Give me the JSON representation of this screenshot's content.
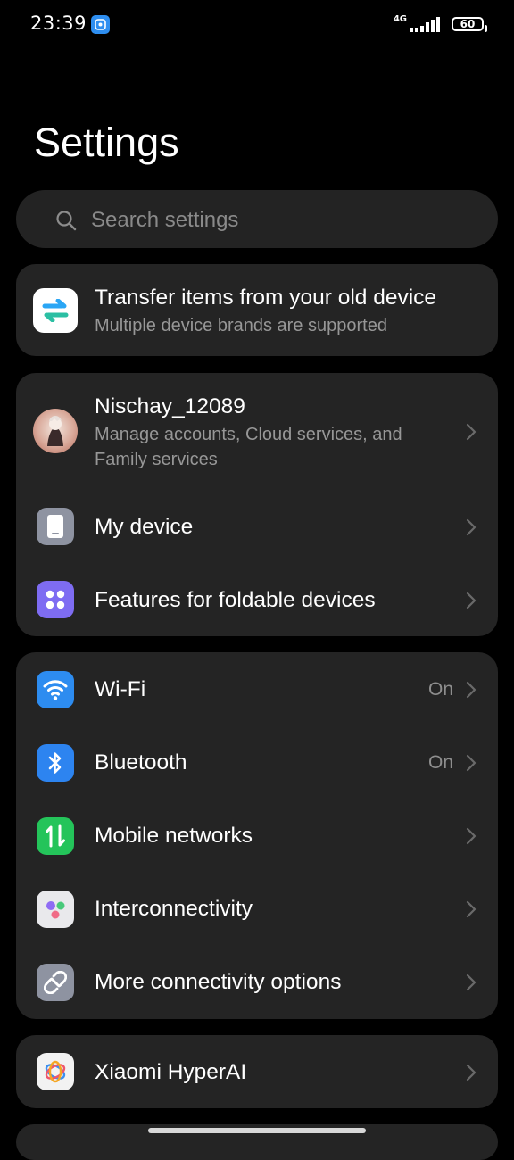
{
  "status_bar": {
    "time": "23:39",
    "network": "4G",
    "battery": "60"
  },
  "page": {
    "title": "Settings"
  },
  "search": {
    "placeholder": "Search settings"
  },
  "transfer": {
    "title": "Transfer items from your old device",
    "subtitle": "Multiple device brands are supported",
    "icon": "transfer-icon"
  },
  "account": {
    "name": "Nischay_12089",
    "subtitle": "Manage accounts, Cloud services, and Family services"
  },
  "device_group": [
    {
      "label": "My device",
      "icon": "phone-icon",
      "color": "#8e93a1"
    },
    {
      "label": "Features for foldable devices",
      "icon": "apps-grid-icon",
      "color": "#7e6cf2"
    }
  ],
  "connectivity_group": [
    {
      "label": "Wi-Fi",
      "value": "On",
      "icon": "wifi-icon",
      "color": "#2d8cf0"
    },
    {
      "label": "Bluetooth",
      "value": "On",
      "icon": "bluetooth-icon",
      "color": "#2d84f0"
    },
    {
      "label": "Mobile networks",
      "value": "",
      "icon": "mobile-data-icon",
      "color": "#24c45a"
    },
    {
      "label": "Interconnectivity",
      "value": "",
      "icon": "interconnectivity-icon",
      "color": "#e6e6e6"
    },
    {
      "label": "More connectivity options",
      "value": "",
      "icon": "link-icon",
      "color": "#8e93a1"
    }
  ],
  "ai_group": [
    {
      "label": "Xiaomi HyperAI",
      "icon": "hyperai-icon",
      "color": "#f2f2f2"
    }
  ]
}
